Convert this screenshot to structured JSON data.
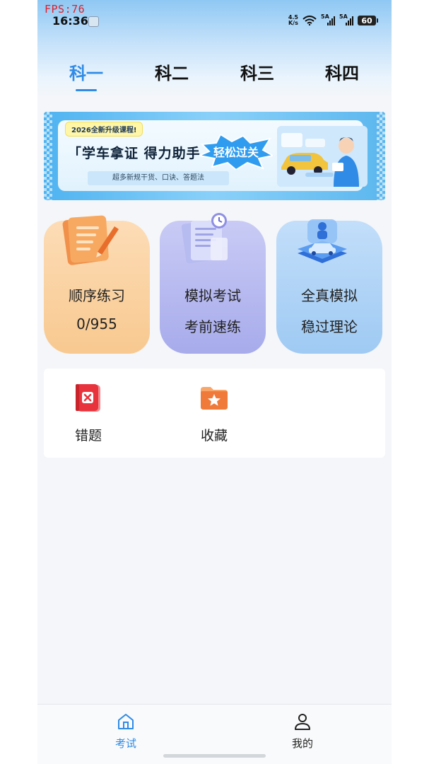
{
  "status_bar": {
    "fps": "FPS:76",
    "time": "16:36",
    "net_speed_top": "4.5",
    "net_speed_bottom": "K/s",
    "sim1_label": "5A",
    "sim2_label": "5A",
    "battery": "60"
  },
  "tabs": [
    {
      "label": "科一",
      "active": true
    },
    {
      "label": "科二",
      "active": false
    },
    {
      "label": "科三",
      "active": false
    },
    {
      "label": "科四",
      "active": false
    }
  ],
  "banner": {
    "tag": "2026全新升级课程!",
    "title": "「学车拿证 得力助手",
    "highlight": "轻松过关",
    "subtitle": "超多新规干货、口诀、答题法"
  },
  "cards": [
    {
      "line1": "顺序练习",
      "line2": "0/955",
      "icon": "notebook-pencil-icon"
    },
    {
      "line1": "模拟考试",
      "line2": "考前速练",
      "icon": "documents-clock-icon"
    },
    {
      "line1": "全真模拟",
      "line2": "稳过理论",
      "icon": "driving-car-platform-icon"
    }
  ],
  "tools": [
    {
      "label": "错题",
      "icon": "wrong-book-icon"
    },
    {
      "label": "收藏",
      "icon": "star-folder-icon"
    }
  ],
  "bottom_nav": [
    {
      "label": "考试",
      "icon": "home-icon",
      "active": true
    },
    {
      "label": "我的",
      "icon": "user-icon",
      "active": false
    }
  ],
  "colors": {
    "accent": "#2f8be6",
    "card1": "#f8c990",
    "card2": "#a7abeb",
    "card3": "#9fcaf3",
    "wrong_red": "#e8333c",
    "favorite_orange": "#f07a3a"
  }
}
